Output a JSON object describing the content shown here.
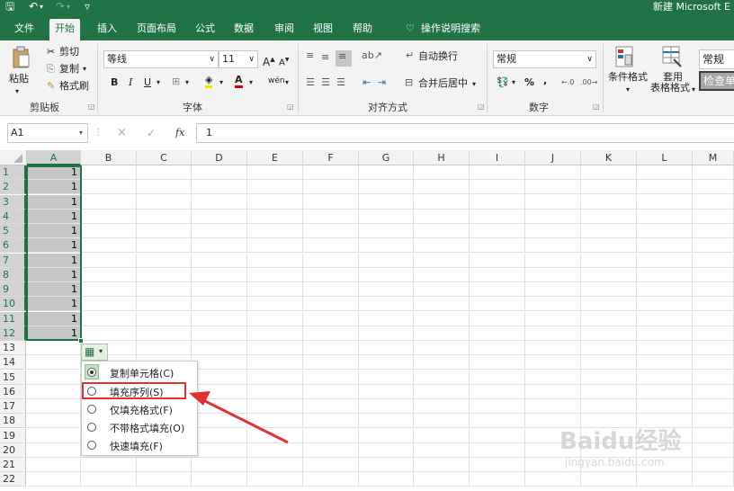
{
  "title": {
    "text": "新建 Microsoft E",
    "save_glyph": "🖫",
    "undo_glyph": "↶",
    "redo_glyph": "↷",
    "customize_glyph": "▿"
  },
  "tabs": [
    "文件",
    "开始",
    "插入",
    "页面布局",
    "公式",
    "数据",
    "审阅",
    "视图",
    "帮助"
  ],
  "tell_me": "操作说明搜索",
  "ribbon": {
    "clipboard": {
      "paste": "粘贴",
      "cut": "剪切",
      "copy": "复制",
      "painter": "格式刷",
      "group": "剪贴板"
    },
    "font": {
      "name": "等线",
      "size": "11",
      "group": "字体",
      "bold": "B",
      "italic": "I",
      "underline": "U",
      "grow": "A",
      "shrink": "A",
      "fontcolor": "A",
      "phonetic": "wén"
    },
    "alignment": {
      "wrap": "自动换行",
      "merge": "合并后居中",
      "group": "对齐方式"
    },
    "number": {
      "format": "常规",
      "percent": "%",
      "comma": ",",
      "group": "数字"
    },
    "styles": {
      "conditional": "条件格式",
      "table_line1": "套用",
      "table_line2": "表格格式",
      "style_normal": "常规",
      "style_check": "检查单"
    }
  },
  "formula_bar": {
    "name_box": "A1",
    "cancel": "×",
    "enter": "✓",
    "fx": "fx",
    "content": "1"
  },
  "columns": [
    "A",
    "B",
    "C",
    "D",
    "E",
    "F",
    "G",
    "H",
    "I",
    "J",
    "K",
    "L",
    "M"
  ],
  "rows": [
    "1",
    "2",
    "3",
    "4",
    "5",
    "6",
    "7",
    "8",
    "9",
    "10",
    "11",
    "12",
    "13",
    "14",
    "15",
    "16",
    "17",
    "18",
    "19",
    "20",
    "21",
    "22"
  ],
  "cells_A": [
    "1",
    "1",
    "1",
    "1",
    "1",
    "1",
    "1",
    "1",
    "1",
    "1",
    "1",
    "1"
  ],
  "autofill_menu": {
    "options": [
      "复制单元格(C)",
      "填充序列(S)",
      "仅填充格式(F)",
      "不带格式填充(O)",
      "快速填充(F)"
    ],
    "selected": 0,
    "highlighted": 1
  },
  "watermark": {
    "brand": "Baidu经验",
    "url": "jingyan.baidu.com"
  },
  "colors": {
    "accent": "#217346",
    "highlight": "#e03030"
  }
}
